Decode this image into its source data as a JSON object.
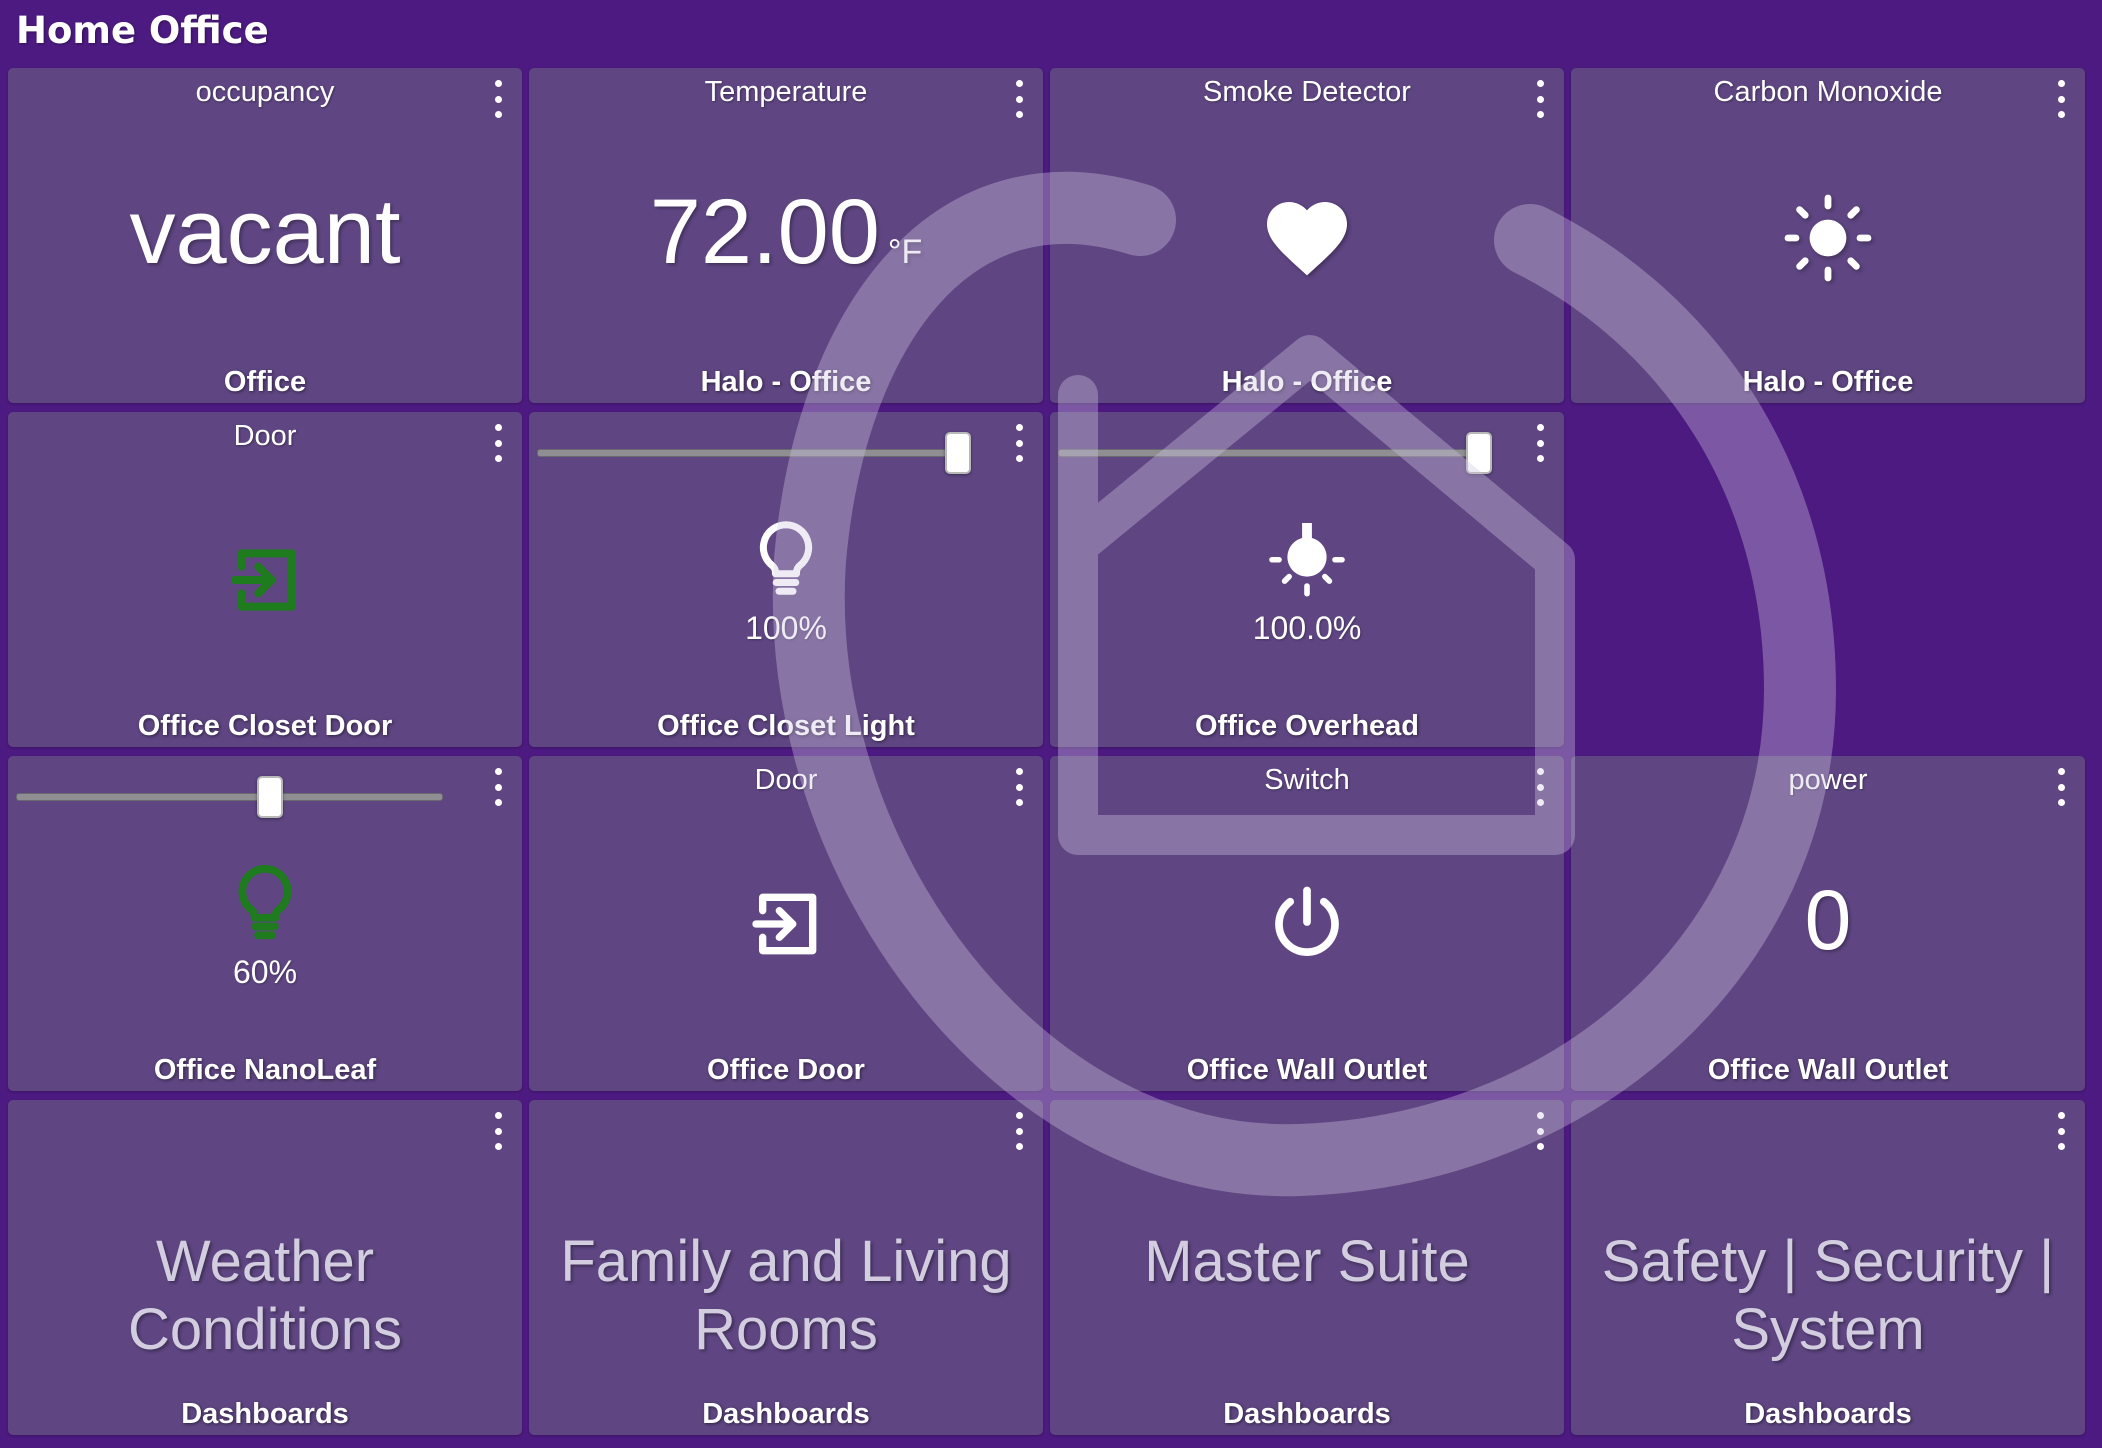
{
  "header": {
    "title": "Home Office"
  },
  "colors": {
    "background": "#4c1a80",
    "tile": "#5f4683",
    "active_green": "#1e7b1e"
  },
  "tiles": [
    {
      "title": "occupancy",
      "value": "vacant",
      "footer": "Office"
    },
    {
      "title": "Temperature",
      "value": "72.00",
      "unit": "°F",
      "footer": "Halo - Office"
    },
    {
      "title": "Smoke Detector",
      "icon": "heart-icon",
      "footer": "Halo - Office"
    },
    {
      "title": "Carbon Monoxide",
      "icon": "sun-icon",
      "footer": "Halo - Office"
    },
    {
      "title": "Door",
      "icon": "door-enter-icon",
      "icon_color": "#1e7b1e",
      "footer": "Office Closet Door"
    },
    {
      "level": "100%",
      "slider_value": 1.0,
      "icon": "bulb-icon",
      "footer": "Office Closet Light"
    },
    {
      "level": "100.0%",
      "slider_value": 1.0,
      "icon": "ceiling-light-icon",
      "footer": "Office Overhead"
    },
    {},
    {
      "level": "60%",
      "slider_value": 0.6,
      "icon": "bulb-icon",
      "icon_color": "#1e7b1e",
      "footer": "Office NanoLeaf"
    },
    {
      "title": "Door",
      "icon": "door-enter-icon",
      "footer": "Office Door"
    },
    {
      "title": "Switch",
      "icon": "power-icon",
      "footer": "Office Wall Outlet"
    },
    {
      "title": "power",
      "value": "0",
      "footer": "Office Wall Outlet"
    },
    {
      "dashboard": "Weather Conditions",
      "footer": "Dashboards"
    },
    {
      "dashboard": "Family and Living Rooms",
      "footer": "Dashboards"
    },
    {
      "dashboard": "Master Suite",
      "footer": "Dashboards"
    },
    {
      "dashboard": "Safety | Security | System",
      "footer": "Dashboards"
    }
  ]
}
